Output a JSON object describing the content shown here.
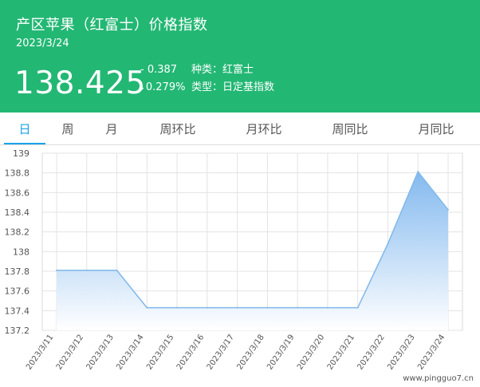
{
  "header": {
    "title": "产区苹果（红富士）价格指数",
    "date": "2023/3/24",
    "price": "138.425",
    "change": "- 0.387",
    "change_pct": "↓0.279%",
    "variety": "种类：红富士",
    "type": "类型：日定基指数"
  },
  "tabs": [
    "日",
    "周",
    "月",
    "周环比",
    "月环比",
    "周同比",
    "月同比"
  ],
  "active_tab": "日",
  "watermark": "www.pingguo7.cn",
  "colors": {
    "header_bg": "#23b774",
    "active_tab": "#1aa3e8",
    "line": "#7fb8ea",
    "area_top": "#7eb6ee",
    "area_bottom": "#ffffff"
  },
  "chart_data": {
    "type": "area",
    "x": [
      "2023/3/11",
      "2023/3/12",
      "2023/3/13",
      "2023/3/14",
      "2023/3/15",
      "2023/3/16",
      "2023/3/17",
      "2023/3/18",
      "2023/3/19",
      "2023/3/20",
      "2023/3/21",
      "2023/3/22",
      "2023/3/23",
      "2023/3/24"
    ],
    "series": [
      {
        "values": [
          137.81,
          137.81,
          137.81,
          137.43,
          137.43,
          137.43,
          137.43,
          137.43,
          137.43,
          137.43,
          137.43,
          138.08,
          138.812,
          138.425
        ]
      }
    ],
    "ylim": [
      137.2,
      139
    ],
    "yticks": [
      "137.2",
      "137.4",
      "137.6",
      "137.8",
      "138",
      "138.2",
      "138.4",
      "138.6",
      "138.8",
      "139"
    ],
    "grid": true
  }
}
